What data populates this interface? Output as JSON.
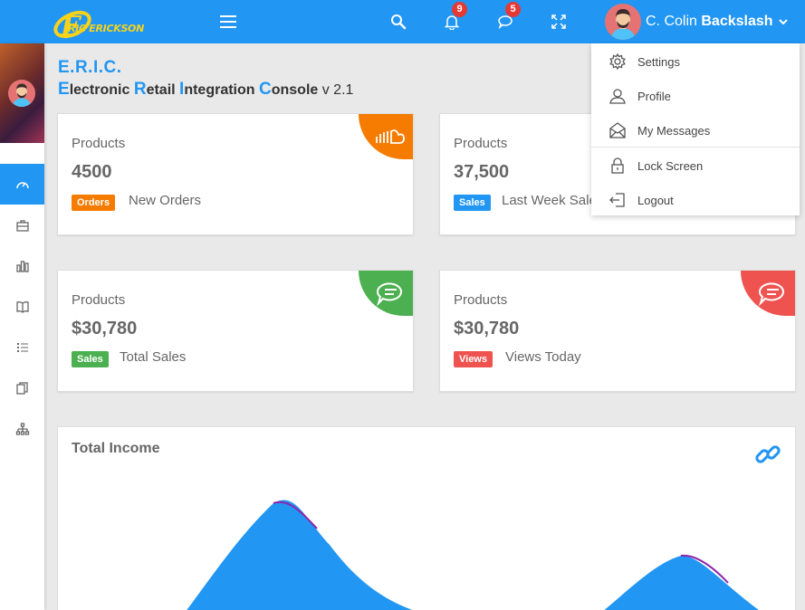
{
  "topbar": {
    "logo_text": "RIC ERICKSON",
    "notifications_count": "9",
    "messages_count": "5",
    "user_first": "C. Colin",
    "user_last": "Backslash"
  },
  "header": {
    "title": "E.R.I.C.",
    "subtitle_parts": [
      "E",
      "lectronic ",
      "R",
      "etail ",
      "I",
      "ntegration ",
      "C",
      "onsole"
    ],
    "version": "v 2.1"
  },
  "cards": [
    {
      "label": "Products",
      "value": "4500",
      "tag": "Orders",
      "desc": "New Orders",
      "tag_color": "#f57c00",
      "corner_color": "#f57c00",
      "icon": "soundcloud-icon"
    },
    {
      "label": "Products",
      "value": "37,500",
      "tag": "Sales",
      "desc": "Last Week Sales",
      "tag_color": "#2196f3",
      "corner_color": "#2196f3",
      "icon": "chart-icon"
    },
    {
      "label": "Products",
      "value": "$30,780",
      "tag": "Sales",
      "desc": "Total Sales",
      "tag_color": "#4caf50",
      "corner_color": "#4caf50",
      "icon": "chat-icon"
    },
    {
      "label": "Products",
      "value": "$30,780",
      "tag": "Views",
      "desc": "Views Today",
      "tag_color": "#ef5350",
      "corner_color": "#ef5350",
      "icon": "chat-icon"
    }
  ],
  "income": {
    "title": "Total Income"
  },
  "dropdown": {
    "items": [
      {
        "label": "Settings",
        "icon": "gear-icon"
      },
      {
        "label": "Profile",
        "icon": "user-icon"
      },
      {
        "label": "My Messages",
        "icon": "envelope-open-icon"
      },
      {
        "label": "Lock Screen",
        "icon": "lock-icon"
      },
      {
        "label": "Logout",
        "icon": "logout-icon"
      }
    ]
  },
  "colors": {
    "primary": "#2196f3"
  }
}
